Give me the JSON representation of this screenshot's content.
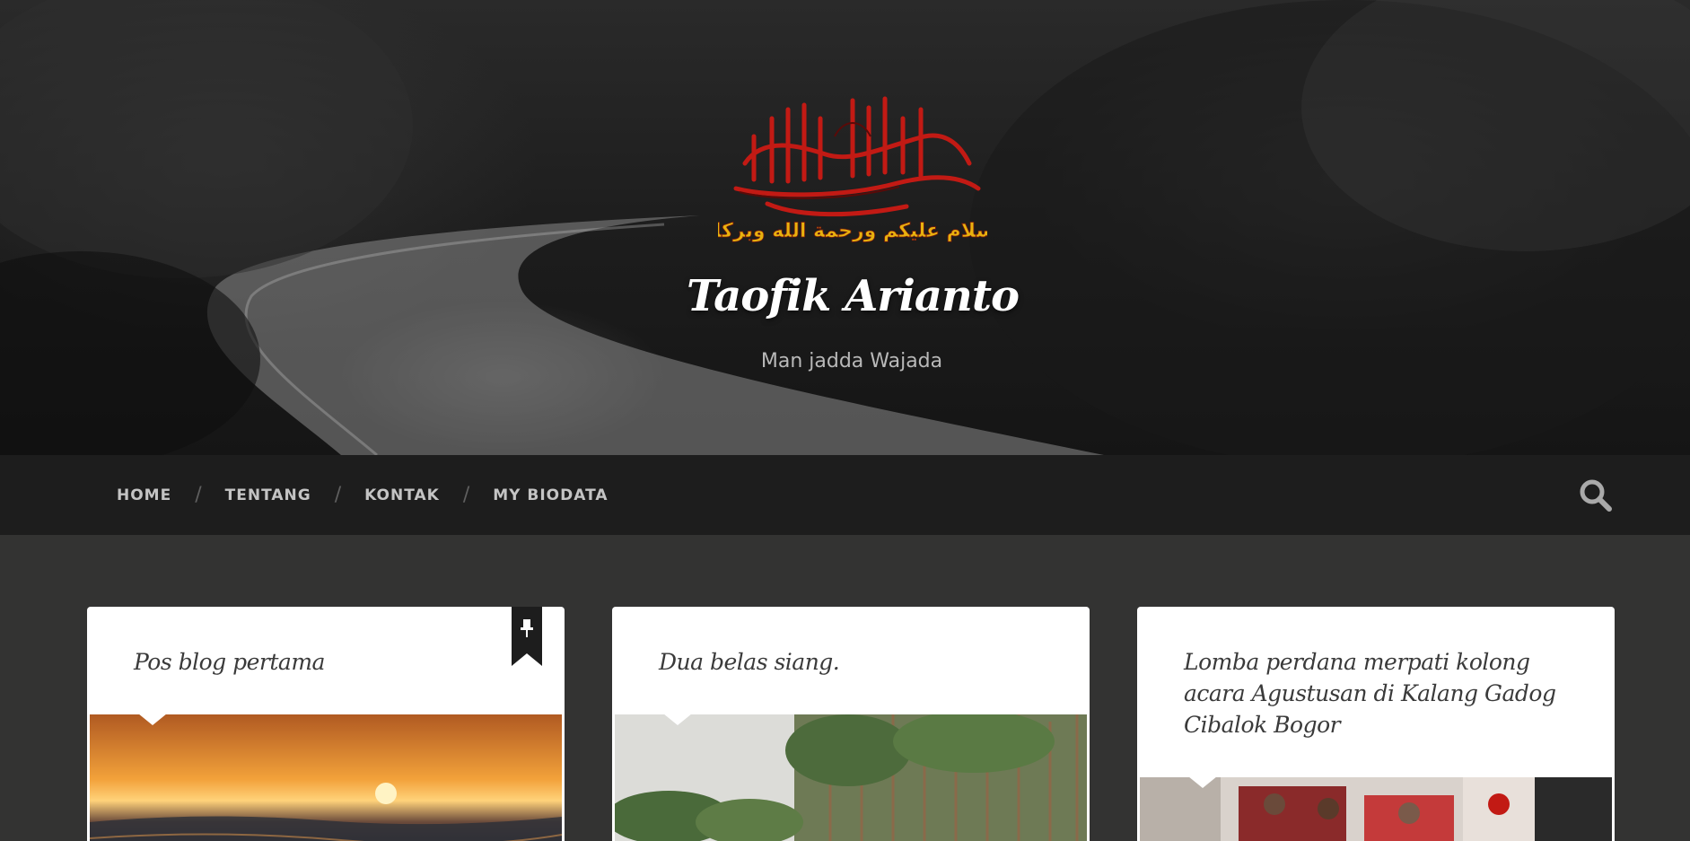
{
  "site": {
    "title": "Taofik Arianto",
    "tagline": "Man jadda Wajada",
    "logo_icon": "arabic-calligraphy-logo",
    "logo_text": "السلام عليكم ورحمة الله وبركاته"
  },
  "nav": {
    "items": [
      {
        "label": "HOME"
      },
      {
        "label": "TENTANG"
      },
      {
        "label": "KONTAK"
      },
      {
        "label": "MY BIODATA"
      }
    ],
    "separator": "/",
    "search_icon": "search-icon"
  },
  "posts": [
    {
      "title": "Pos blog pertama",
      "sticky": true,
      "sticky_icon": "pushpin-icon",
      "image": "sunset-over-sea"
    },
    {
      "title": "Dua belas siang.",
      "sticky": false,
      "image": "pine-forest"
    },
    {
      "title": "Lomba perdana merpati kolong acara Agustusan di Kalang Gadog Cibalok Bogor",
      "sticky": false,
      "image": "crowd-event"
    }
  ],
  "colors": {
    "page_bg": "#333332",
    "nav_bg": "#1d1d1d",
    "card_bg": "#ffffff",
    "title_text": "#ffffff",
    "tagline_text": "#b9b9b9",
    "nav_text": "#c4c4c4",
    "post_title_text": "#3a3a3a"
  }
}
